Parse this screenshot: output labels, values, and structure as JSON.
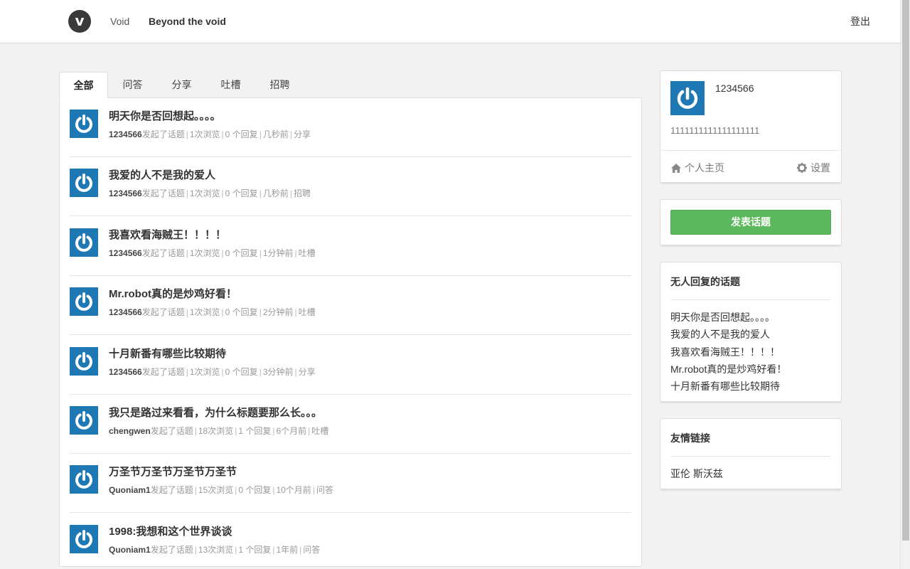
{
  "header": {
    "logo_glyph": "v",
    "links": [
      {
        "label": "Void"
      },
      {
        "label": "Beyond the void"
      }
    ],
    "logout_label": "登出"
  },
  "tabs": [
    {
      "label": "全部",
      "active": true
    },
    {
      "label": "问答",
      "active": false
    },
    {
      "label": "分享",
      "active": false
    },
    {
      "label": "吐槽",
      "active": false
    },
    {
      "label": "招聘",
      "active": false
    }
  ],
  "topics": [
    {
      "title": "明天你是否回想起。。。。",
      "author": "1234566",
      "action": "发起了话题",
      "views": "1次浏览",
      "replies": "0 个回复",
      "time": "几秒前",
      "category": "分享"
    },
    {
      "title": "我爱的人不是我的爱人",
      "author": "1234566",
      "action": "发起了话题",
      "views": "1次浏览",
      "replies": "0 个回复",
      "time": "几秒前",
      "category": "招聘"
    },
    {
      "title": "我喜欢看海贼王！！！！",
      "author": "1234566",
      "action": "发起了话题",
      "views": "1次浏览",
      "replies": "0 个回复",
      "time": "1分钟前",
      "category": "吐槽"
    },
    {
      "title": "Mr.robot真的是炒鸡好看！",
      "author": "1234566",
      "action": "发起了话题",
      "views": "1次浏览",
      "replies": "0 个回复",
      "time": "2分钟前",
      "category": "吐槽"
    },
    {
      "title": "十月新番有哪些比较期待",
      "author": "1234566",
      "action": "发起了话题",
      "views": "1次浏览",
      "replies": "0 个回复",
      "time": "3分钟前",
      "category": "分享"
    },
    {
      "title": "我只是路过来看看，为什么标题要那么长。。。",
      "author": "chengwen",
      "action": "发起了话题",
      "views": "18次浏览",
      "replies": "1 个回复",
      "time": "6个月前",
      "category": "吐槽"
    },
    {
      "title": "万圣节万圣节万圣节万圣节",
      "author": "Quoniam1",
      "action": "发起了话题",
      "views": "15次浏览",
      "replies": "0 个回复",
      "time": "10个月前",
      "category": "问答"
    },
    {
      "title": "1998:我想和这个世界谈谈",
      "author": "Quoniam1",
      "action": "发起了话题",
      "views": "13次浏览",
      "replies": "1 个回复",
      "time": "1年前",
      "category": "问答"
    }
  ],
  "user": {
    "name": "1234566",
    "signature": "1111111111111111111",
    "home_label": "个人主页",
    "settings_label": "设置"
  },
  "post_button_label": "发表话题",
  "unreplied": {
    "heading": "无人回复的话题",
    "items": [
      "明天你是否回想起。。。。",
      "我爱的人不是我的爱人",
      "我喜欢看海贼王！！！！",
      "Mr.robot真的是炒鸡好看！",
      "十月新番有哪些比较期待"
    ]
  },
  "friend_links": {
    "heading": "友情链接",
    "items": [
      "亚伦 斯沃兹"
    ]
  },
  "colors": {
    "avatar_blue": "#1e78b4",
    "primary_green": "#5cb85c",
    "meta_gray": "#999999"
  },
  "icons": {
    "home": "home-icon",
    "settings": "gear-icon",
    "avatar": "power-icon"
  }
}
